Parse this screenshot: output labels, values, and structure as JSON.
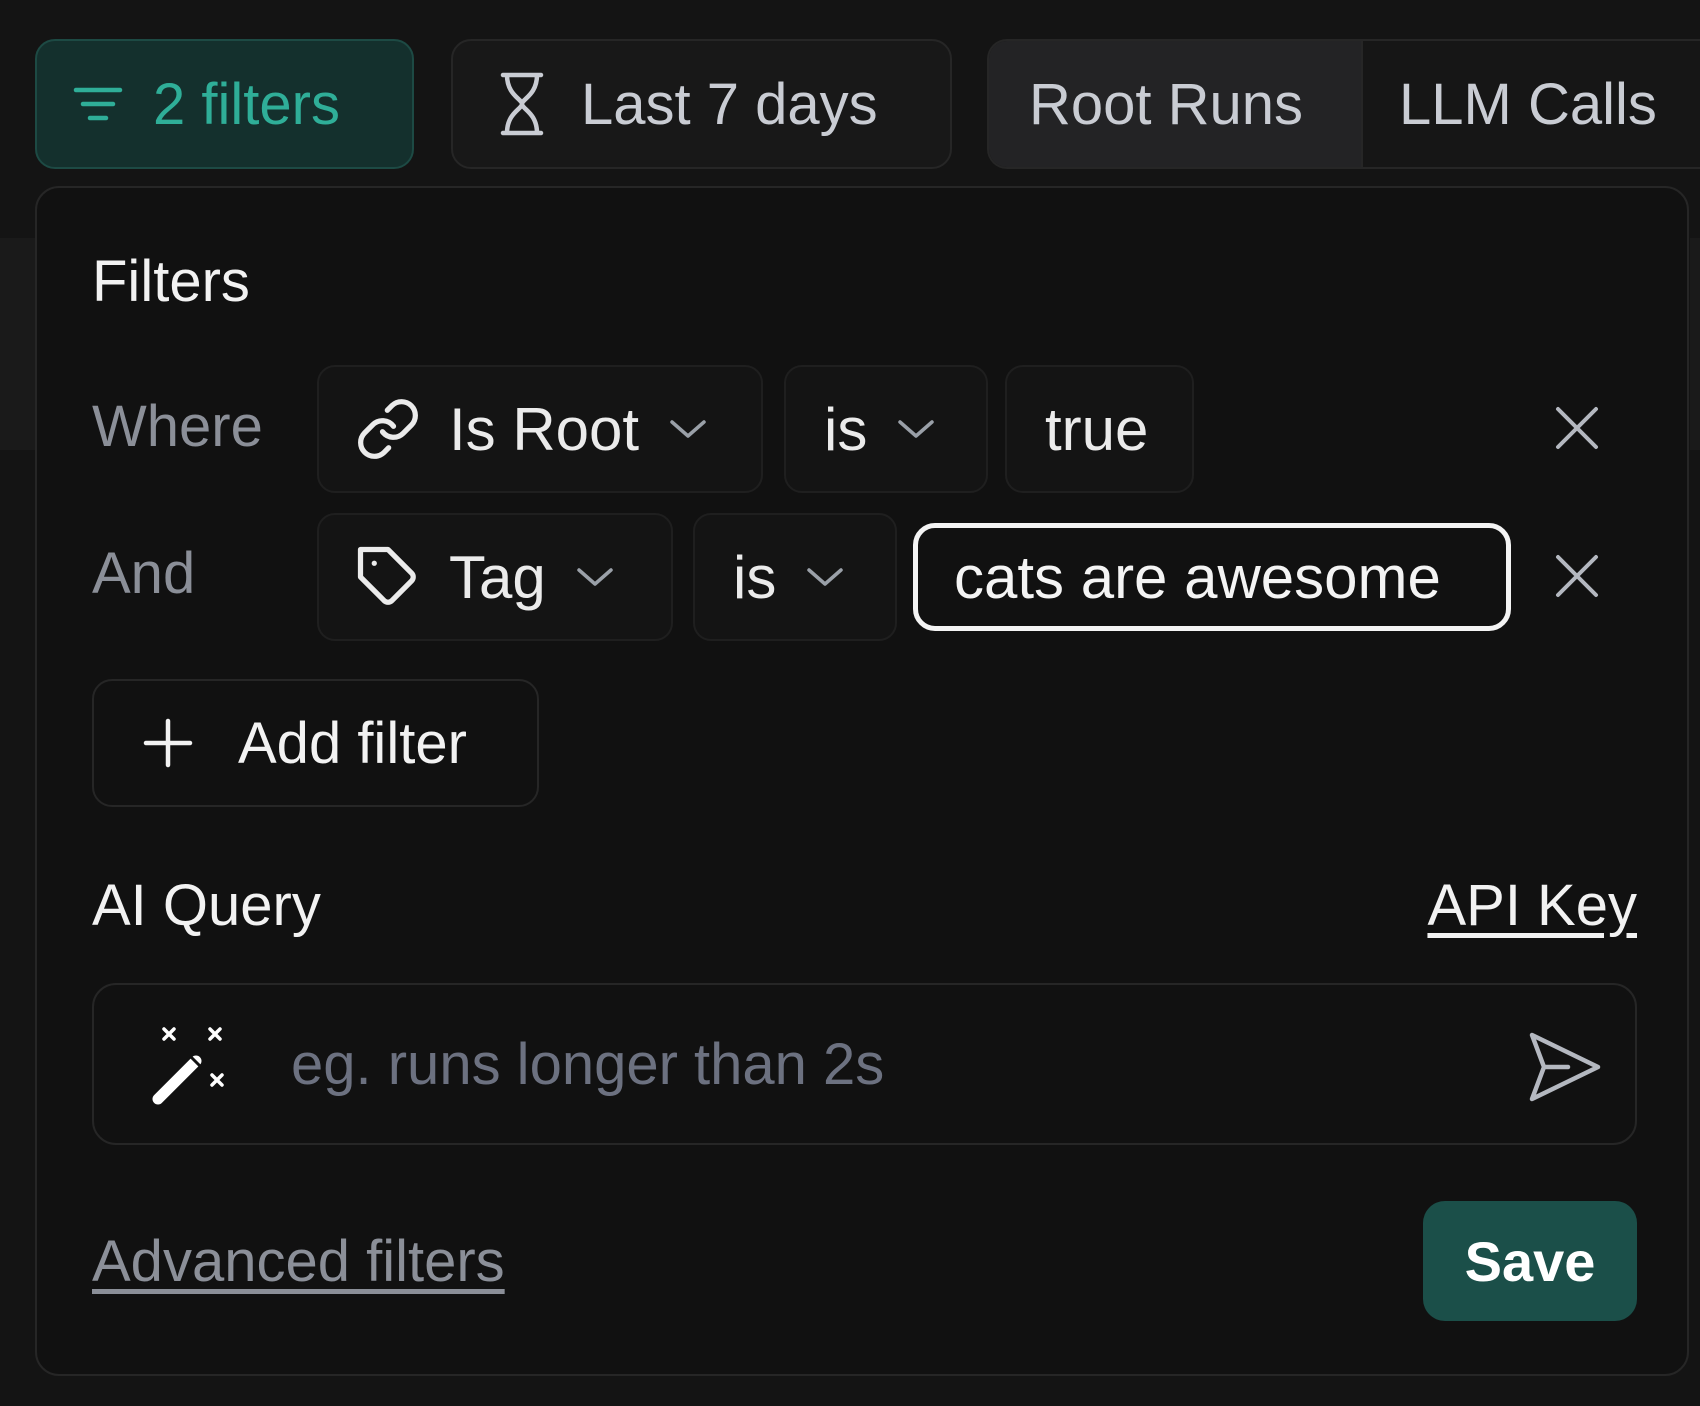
{
  "toolbar": {
    "filters_label": "2 filters",
    "range_label": "Last 7 days",
    "tabs": [
      {
        "label": "Root Runs",
        "active": true
      },
      {
        "label": "LLM Calls",
        "active": false
      }
    ]
  },
  "popover": {
    "title": "Filters",
    "rows": [
      {
        "connector": "Where",
        "field": "Is Root",
        "field_icon": "link-icon",
        "operator": "is",
        "value": "true"
      },
      {
        "connector": "And",
        "field": "Tag",
        "field_icon": "tag-icon",
        "operator": "is",
        "value": "cats are awesome"
      }
    ],
    "add_filter_label": "Add filter",
    "ai_query": {
      "title": "AI Query",
      "api_key_link": "API Key",
      "placeholder": "eg. runs longer than 2s",
      "value": ""
    },
    "advanced_link": "Advanced filters",
    "save_label": "Save"
  },
  "colors": {
    "accent": "#2fae98",
    "save_bg": "#1b4f49",
    "background": "#111111"
  }
}
